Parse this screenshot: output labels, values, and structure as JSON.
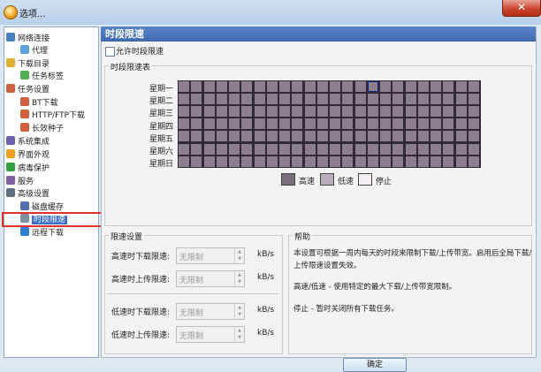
{
  "window": {
    "title": "选项...",
    "close_label": "✕"
  },
  "sidebar": {
    "items": [
      {
        "label": "网络连接",
        "icon": "network-icon",
        "color": "#4a7fc0",
        "indent": 0
      },
      {
        "label": "代理",
        "icon": "proxy-icon",
        "color": "#5aa0e0",
        "indent": 1
      },
      {
        "label": "下载目录",
        "icon": "folder-icon",
        "color": "#e0b030",
        "indent": 0
      },
      {
        "label": "任务标签",
        "icon": "tag-icon",
        "color": "#50b050",
        "indent": 1
      },
      {
        "label": "任务设置",
        "icon": "task-icon",
        "color": "#d06040",
        "indent": 0
      },
      {
        "label": "BT下载",
        "icon": "bt-icon",
        "color": "#d06040",
        "indent": 1
      },
      {
        "label": "HTTP/FTP下载",
        "icon": "http-icon",
        "color": "#d06040",
        "indent": 1
      },
      {
        "label": "长效种子",
        "icon": "seed-icon",
        "color": "#d06040",
        "indent": 1
      },
      {
        "label": "系统集成",
        "icon": "system-icon",
        "color": "#7060b0",
        "indent": 0
      },
      {
        "label": "界面外观",
        "icon": "appearance-icon",
        "color": "#f0a020",
        "indent": 0
      },
      {
        "label": "病毒保护",
        "icon": "shield-icon",
        "color": "#30a040",
        "indent": 0
      },
      {
        "label": "服务",
        "icon": "service-icon",
        "color": "#8060a0",
        "indent": 0
      },
      {
        "label": "高级设置",
        "icon": "advanced-icon",
        "color": "#607080",
        "indent": 0
      },
      {
        "label": "磁盘缓存",
        "icon": "disk-icon",
        "color": "#5070b0",
        "indent": 1
      },
      {
        "label": "时段限速",
        "icon": "speed-icon",
        "color": "#8090a0",
        "indent": 1,
        "selected": true
      },
      {
        "label": "远程下载",
        "icon": "remote-icon",
        "color": "#3080d0",
        "indent": 1
      }
    ]
  },
  "main": {
    "header": "时段限速",
    "enable_label": "允许时段限速",
    "schedule_title": "时段限速表",
    "days": [
      "星期一",
      "星期二",
      "星期三",
      "星期四",
      "星期五",
      "星期六",
      "星期日"
    ],
    "legend": [
      {
        "label": "高速",
        "color": "#7a6e7c"
      },
      {
        "label": "低速",
        "color": "#b8aeba"
      },
      {
        "label": "停止",
        "color": "#f4eef4"
      }
    ],
    "speed_title": "限速设置",
    "fields": [
      {
        "label": "高速时下载限速:",
        "value": "无限制",
        "unit": "kB/s"
      },
      {
        "label": "高速时上传限速:",
        "value": "无限制",
        "unit": "kB/s"
      },
      {
        "label": "低速时下载限速:",
        "value": "无限制",
        "unit": "kB/s"
      },
      {
        "label": "低速时上传限速:",
        "value": "无限制",
        "unit": "kB/s"
      }
    ],
    "help_title": "帮助",
    "help_lines": [
      "本设置可根据一周内每天的时段来限制下载/上传带宽。启用后全局下载/上传限速设置失效。",
      "高速/低速 - 使用特定的最大下载/上传带宽限制。",
      "停止 - 暂时关闭所有下载任务。"
    ],
    "ok_label": "确定"
  }
}
